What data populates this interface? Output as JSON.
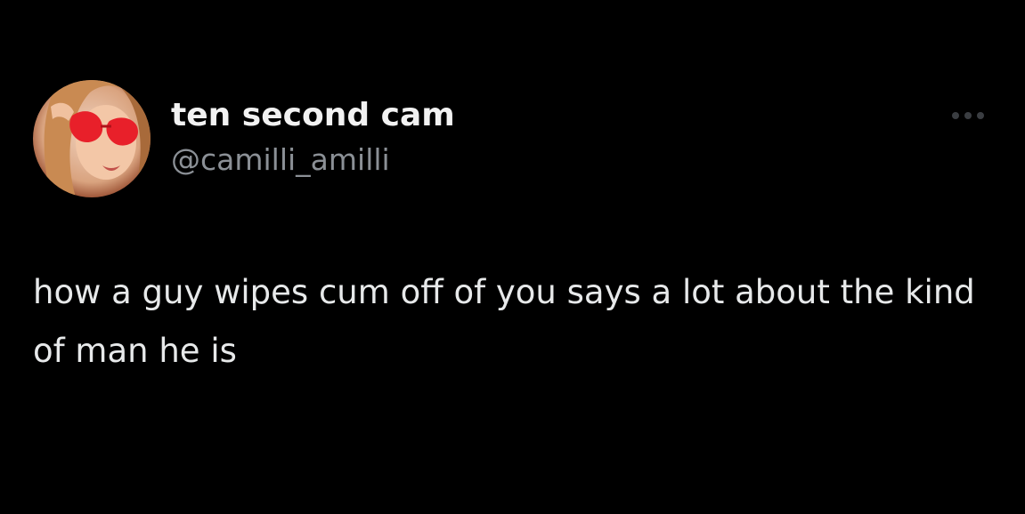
{
  "tweet": {
    "author": {
      "display_name": "ten second cam",
      "handle": "@camilli_amilli",
      "avatar_icon": "profile-photo-avatar"
    },
    "more_icon": "ellipsis-icon",
    "text": "how a guy wipes cum off of you says a lot about the kind of man he is"
  },
  "colors": {
    "background": "#000000",
    "name": "#f2f2f2",
    "handle": "#8b9096",
    "text": "#e7e9ea",
    "more_icon": "#3a3d41",
    "avatar_accent": "#e8202a"
  }
}
